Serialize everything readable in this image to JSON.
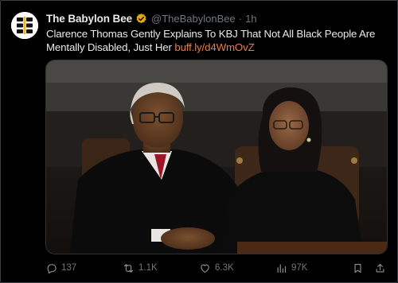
{
  "account": {
    "name": "The Babylon Bee",
    "handle": "@TheBabylonBee",
    "separator": "·",
    "time": "1h",
    "verified_color": "#e2a610"
  },
  "post": {
    "text": "Clarence Thomas Gently Explains To KBJ That Not All Black People Are Mentally Disabled, Just Her ",
    "link": "buff.ly/d4WmOvZ",
    "link_color": "#f07a3b"
  },
  "actions": {
    "replies": "137",
    "reposts": "1.1K",
    "likes": "6.3K",
    "views": "97K"
  },
  "icons": [
    "reply-icon",
    "repost-icon",
    "like-icon",
    "views-icon",
    "bookmark-icon",
    "share-icon",
    "verified-badge-icon",
    "babylon-bee-logo"
  ]
}
